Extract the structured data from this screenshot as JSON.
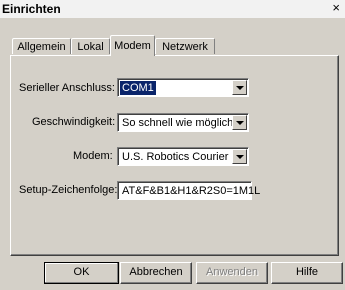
{
  "window": {
    "title": "Einrichten",
    "close_glyph": "×"
  },
  "tabs": [
    {
      "label": "Allgemein",
      "active": false
    },
    {
      "label": "Lokal",
      "active": false
    },
    {
      "label": "Modem",
      "active": true
    },
    {
      "label": "Netzwerk",
      "active": false
    }
  ],
  "form": {
    "serial_port": {
      "label": "Serieller Anschluss:",
      "value": "COM1"
    },
    "speed": {
      "label": "Geschwindigkeit:",
      "value": "So schnell wie möglich"
    },
    "modem": {
      "label": "Modem:",
      "value": "U.S. Robotics Courier"
    },
    "setup_string": {
      "label": "Setup-Zeichenfolge:",
      "value": "AT&F&B1&H1&R2S0=1M1L"
    }
  },
  "buttons": {
    "ok": "OK",
    "cancel": "Abbrechen",
    "apply": "Anwenden",
    "help": "Hilfe"
  },
  "icons": {
    "close": "close-icon",
    "dropdown": "chevron-down-icon"
  }
}
